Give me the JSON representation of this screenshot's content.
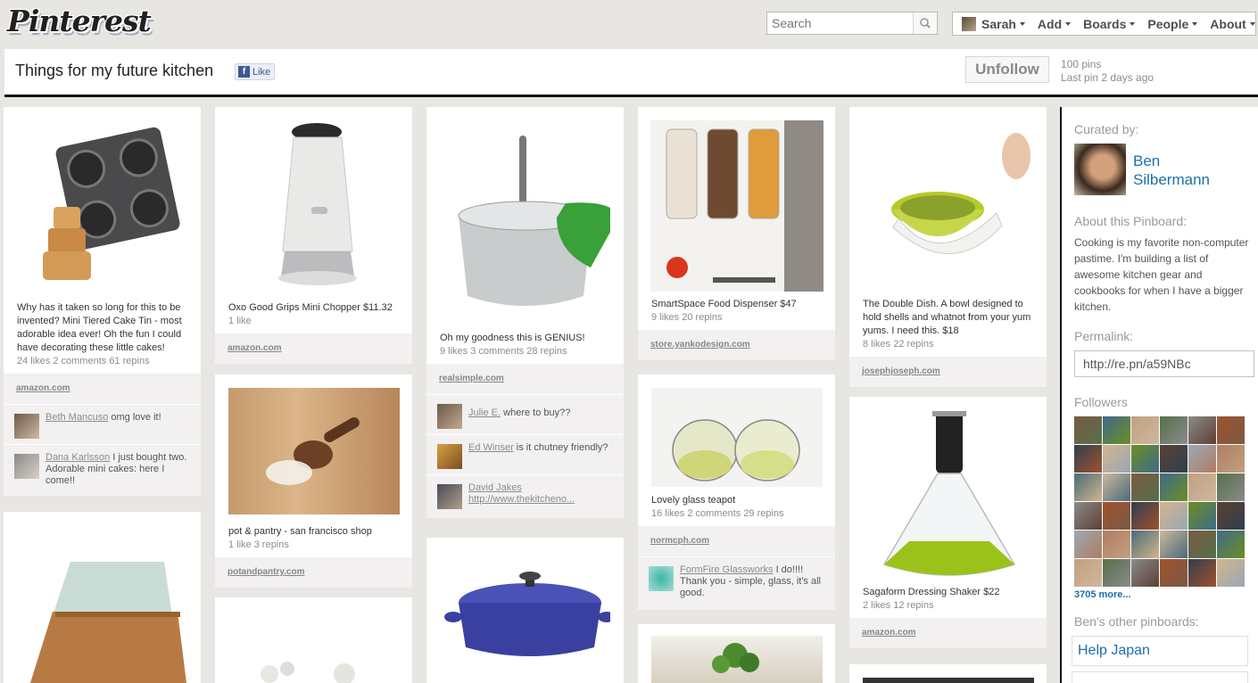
{
  "header": {
    "logo": "Pinterest",
    "search_placeholder": "Search",
    "nav": [
      "Sarah",
      "Add",
      "Boards",
      "People",
      "About"
    ]
  },
  "board": {
    "title": "Things for my future kitchen",
    "like_label": "Like",
    "unfollow_label": "Unfollow",
    "pins_count": "100 pins",
    "last_pin": "Last pin 2 days ago"
  },
  "pins": [
    {
      "desc": "Why has it taken so long for this to be invented? Mini Tiered Cake Tin - most adorable idea ever! Oh the fun I could have decorating these little cakes!",
      "meta": "24 likes  2 comments  61 repins",
      "source": "amazon.com"
    },
    {
      "desc": "Oxo Good Grips Mini Chopper $11.32",
      "meta": "1 like",
      "source": "amazon.com"
    },
    {
      "desc": "Oh my goodness this is GENIUS!",
      "meta": "9 likes  3 comments  28 repins",
      "source": "realsimple.com"
    },
    {
      "desc": "SmartSpace Food Dispenser $47",
      "meta": "9 likes  20 repins",
      "source": "store.yankodesign.com"
    },
    {
      "desc": "The Double Dish. A bowl designed to hold shells and whatnot from your yum yums. I need this. $18",
      "meta": "8 likes  22 repins",
      "source": "josephjoseph.com"
    },
    {
      "desc": "pot & pantry - san francisco shop",
      "meta": "1 like  3 repins",
      "source": "potandpantry.com"
    },
    {
      "desc": "Lovely glass teapot",
      "meta": "16 likes  2 comments  29 repins",
      "source": "normcph.com"
    },
    {
      "desc": "Sagaform Dressing Shaker $22",
      "meta": "2 likes  12 repins",
      "source": "amazon.com"
    }
  ],
  "comments": [
    {
      "name": "Beth Mancuso",
      "text": " omg love it!"
    },
    {
      "name": "Dana Karlsson",
      "text": " I just bought two. Adorable mini cakes: here I come!!"
    },
    {
      "name": "Julie E.",
      "text": " where to buy??"
    },
    {
      "name": "Ed Winser",
      "text": " is it chutney friendly?"
    },
    {
      "name": "David Jakes",
      "text": "http://www.thekitcheno..."
    },
    {
      "name": "FormFire Glassworks",
      "text": " I do!!!! Thank you - simple, glass, it's all good."
    }
  ],
  "sidebar": {
    "curated_by_label": "Curated by:",
    "curator_name": "Ben Silbermann",
    "about_label": "About this Pinboard:",
    "about_text": "Cooking is my favorite non-computer pastime.  I'm  building a list of awesome kitchen gear and cookbooks for when I have a bigger kitchen.",
    "permalink_label": "Permalink:",
    "permalink": "http://re.pn/a59NBc",
    "followers_label": "Followers",
    "more_followers": "3705 more...",
    "other_pinboards_label": "Ben's other pinboards:",
    "other_pinboards": [
      "Help Japan"
    ]
  },
  "colors": {
    "link": "#1d6faa",
    "page_bg": "#e8e6e2",
    "source_bg": "#f2f0f0"
  }
}
